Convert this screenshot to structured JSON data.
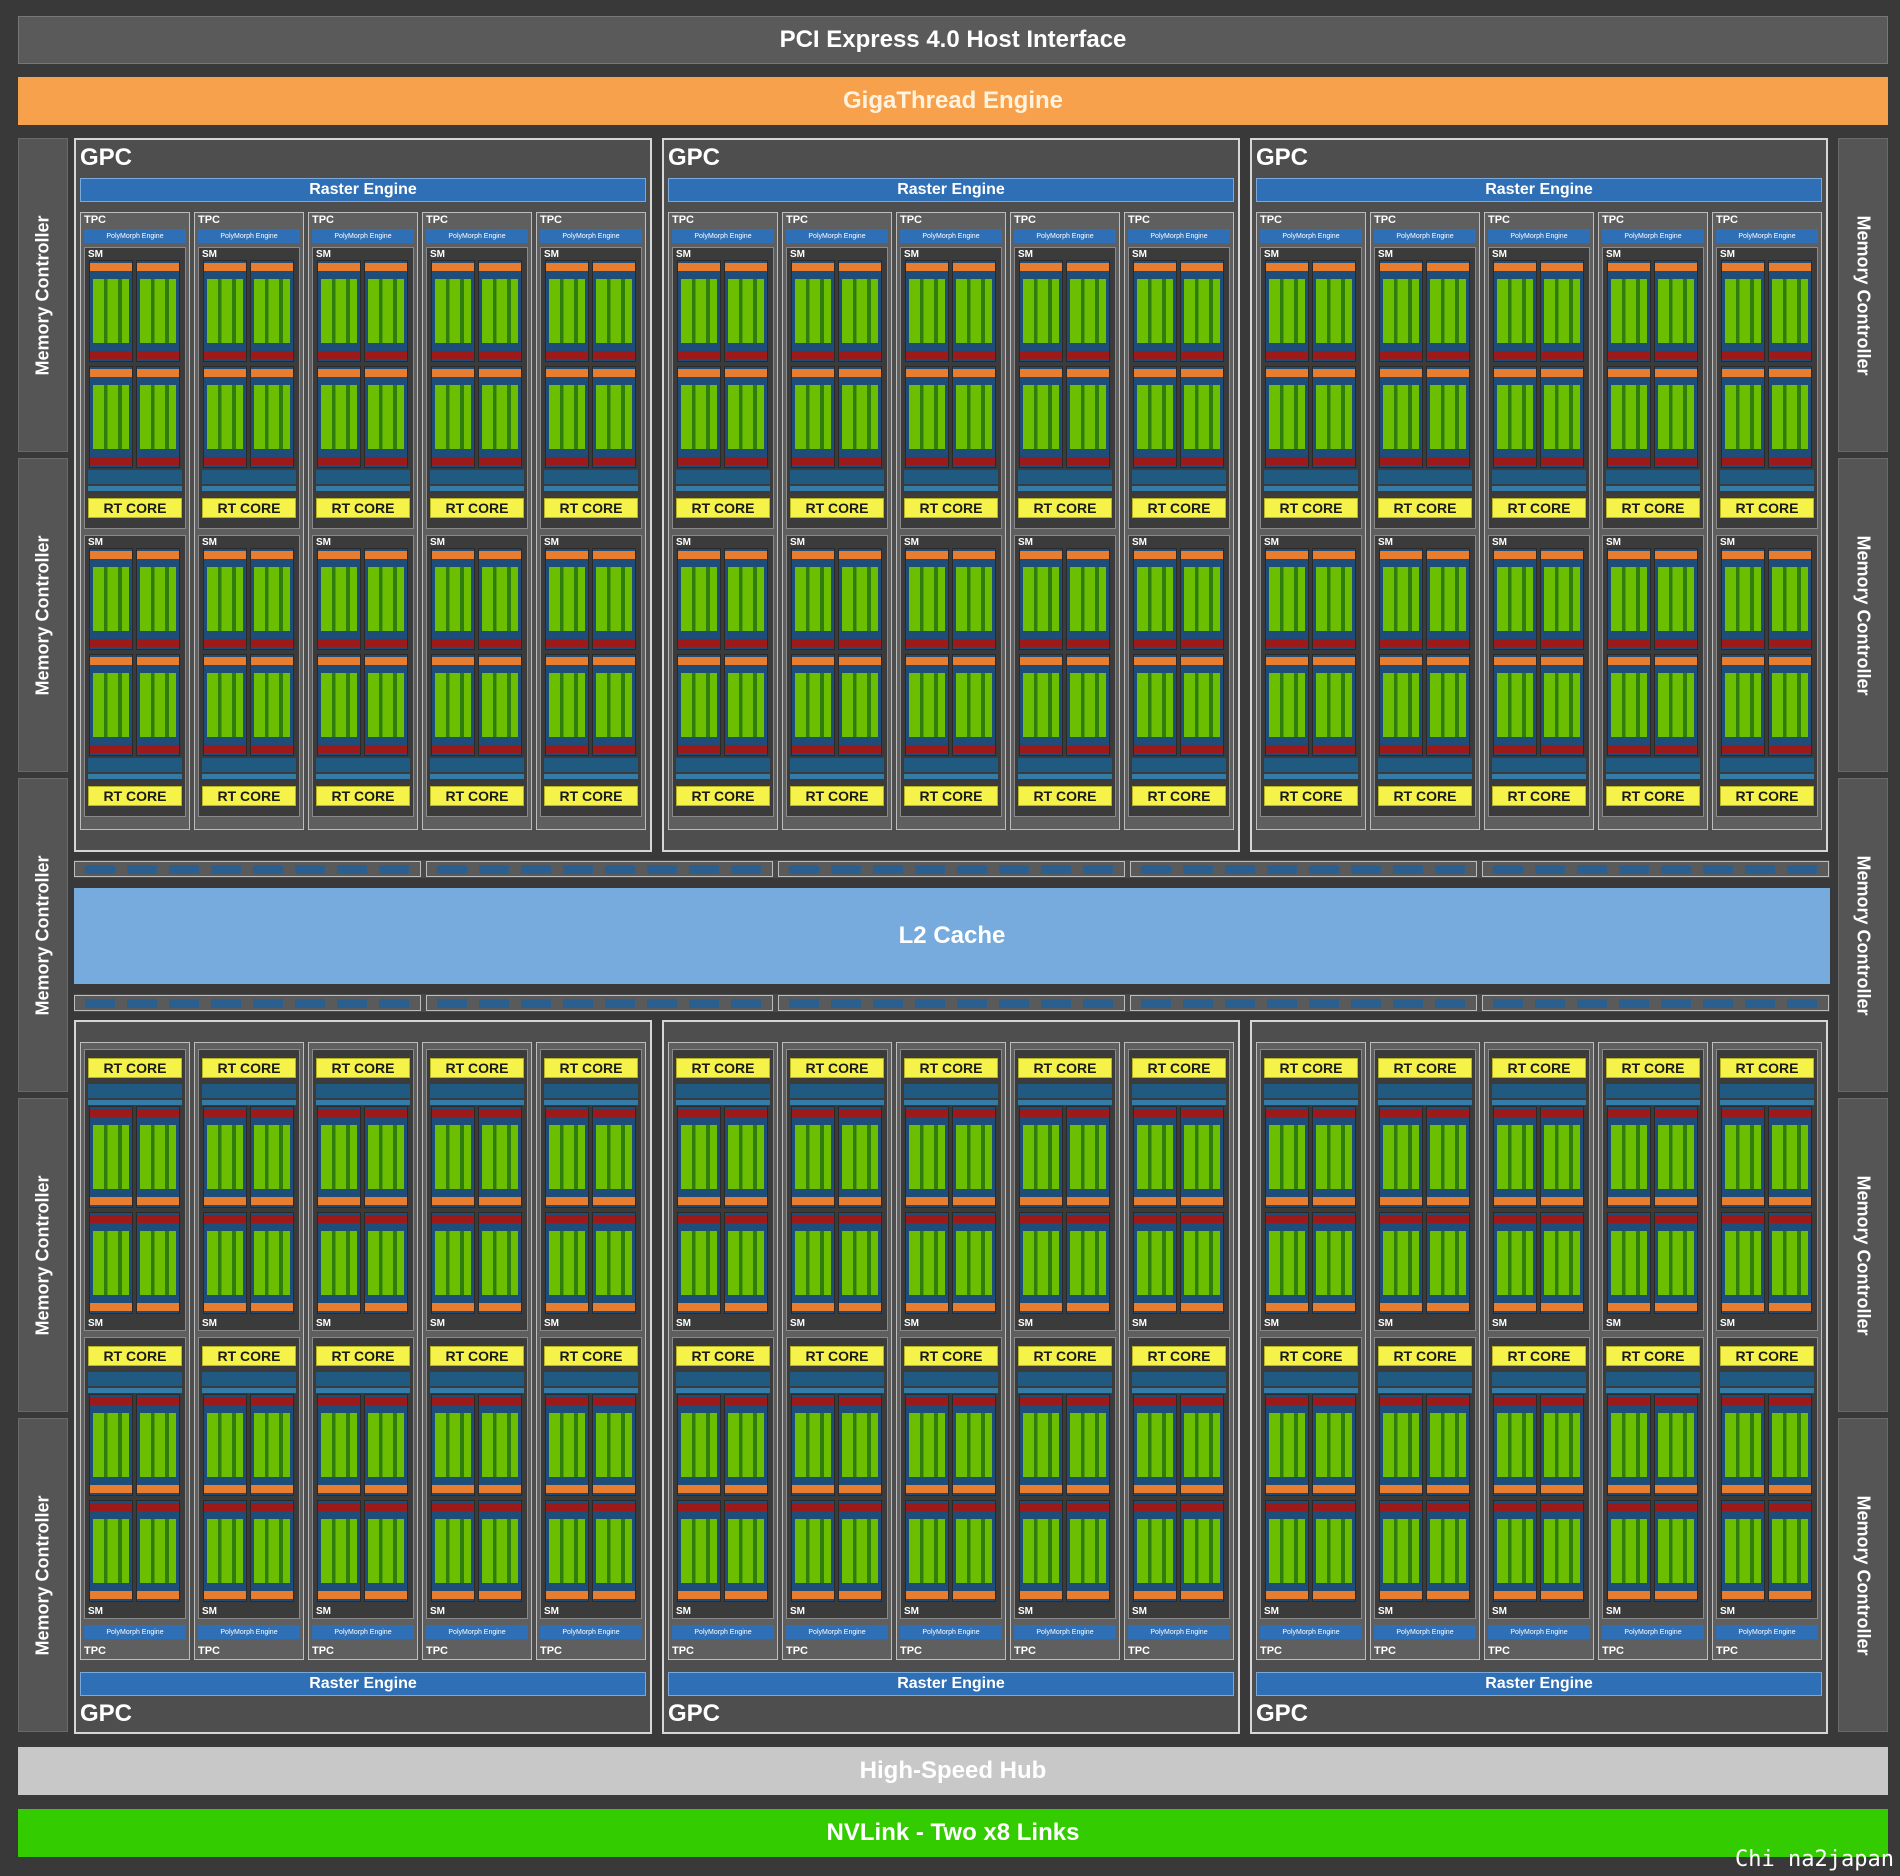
{
  "header": {
    "host_interface": "PCI Express 4.0 Host Interface",
    "gigathread": "GigaThread Engine"
  },
  "memory_controller_label": "Memory Controller",
  "gpc": {
    "label": "GPC",
    "raster_label": "Raster Engine"
  },
  "tpc": {
    "label": "TPC",
    "polymorph_label": "PolyMorph Engine"
  },
  "sm": {
    "label": "SM",
    "rt_core_label": "RT CORE"
  },
  "l2_cache": "L2 Cache",
  "footer": {
    "hub": "High-Speed Hub",
    "nvlink": "NVLink - Two x8 Links"
  },
  "watermark": "Chi na2japan",
  "colors": {
    "host_interface": "#595959",
    "gigathread": "#f7a14c",
    "raster": "#2f6fb6",
    "rt_core": "#f5f24a",
    "cuda_core": "#6cbf00",
    "l2_cache": "#77aadd",
    "hub": "#c8c8c8",
    "nvlink": "#33cc00"
  },
  "counts": {
    "gpcs": 6,
    "tpcs_per_gpc": 5,
    "sms_per_tpc": 2,
    "memory_controllers": 10
  }
}
